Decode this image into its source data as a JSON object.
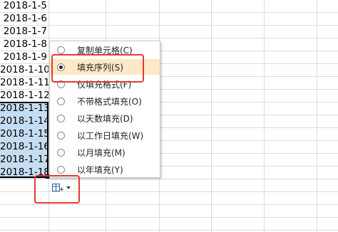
{
  "cells": [
    {
      "value": "2018-1-5"
    },
    {
      "value": "2018-1-6"
    },
    {
      "value": "2018-1-7"
    },
    {
      "value": "2018-1-8"
    },
    {
      "value": "2018-1-9"
    },
    {
      "value": "2018-1-10"
    },
    {
      "value": "2018-1-11"
    },
    {
      "value": "2018-1-12"
    },
    {
      "value": "2018-1-13"
    },
    {
      "value": "2018-1-14"
    },
    {
      "value": "2018-1-15"
    },
    {
      "value": "2018-1-16"
    },
    {
      "value": "2018-1-17"
    },
    {
      "value": "2018-1-18"
    }
  ],
  "autofill_menu": {
    "selected_index": 1,
    "items": [
      {
        "label": "复制单元格(C)"
      },
      {
        "label": "填充序列(S)"
      },
      {
        "label": "仅填充格式(F)"
      },
      {
        "label": "不带格式填充(O)"
      },
      {
        "label": "以天数填充(D)"
      },
      {
        "label": "以工作日填充(W)"
      },
      {
        "label": "以月填充(M)"
      },
      {
        "label": "以年填充(Y)"
      }
    ]
  },
  "colors": {
    "selection_fill": "#c5ddf2",
    "highlight_box": "#e53935",
    "checked_item_bg": "#fde9c8",
    "gridline": "#dadcdd"
  }
}
